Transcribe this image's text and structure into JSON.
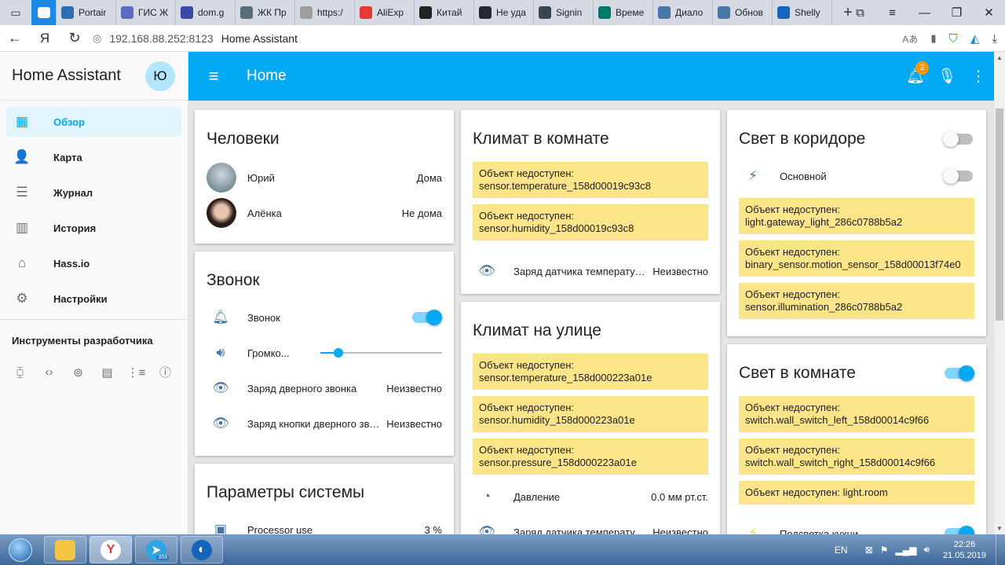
{
  "browser": {
    "tabs": [
      {
        "label": "Portair",
        "color": "#2c6fb5",
        "active": false
      },
      {
        "label": "ГИС Ж",
        "color": "#5c6bc0",
        "active": false
      },
      {
        "label": "dom.g",
        "color": "#3949ab",
        "active": false
      },
      {
        "label": "ЖК Пр",
        "color": "#546e7a",
        "active": false
      },
      {
        "label": "https:/",
        "color": "#9e9e9e",
        "active": false
      },
      {
        "label": "AliExp",
        "color": "#e53935",
        "active": false
      },
      {
        "label": "Китай",
        "color": "#212121",
        "active": false
      },
      {
        "label": "Не уда",
        "color": "#24292e",
        "active": false
      },
      {
        "label": "Signin",
        "color": "#37474f",
        "active": false
      },
      {
        "label": "Време",
        "color": "#00796b",
        "active": false
      },
      {
        "label": "Диало",
        "color": "#4a76a8",
        "active": false
      },
      {
        "label": "Обнов",
        "color": "#4a76a8",
        "active": false
      },
      {
        "label": "Shelly",
        "color": "#1565c0",
        "active": false
      }
    ],
    "address_host": "192.168.88.252:8123",
    "address_title": "Home Assistant"
  },
  "sidebar": {
    "title": "Home Assistant",
    "avatar_initial": "Ю",
    "items": [
      {
        "label": "Обзор",
        "icon": "grid-icon",
        "glyph": "▦",
        "active": true
      },
      {
        "label": "Карта",
        "icon": "account-box-icon",
        "glyph": "👤",
        "active": false
      },
      {
        "label": "Журнал",
        "icon": "list-icon",
        "glyph": "☰",
        "active": false
      },
      {
        "label": "История",
        "icon": "chart-bar-icon",
        "glyph": "▥",
        "active": false
      },
      {
        "label": "Hass.io",
        "icon": "home-assistant-icon",
        "glyph": "⌂",
        "active": false
      },
      {
        "label": "Настройки",
        "icon": "gear-icon",
        "glyph": "⚙",
        "active": false
      }
    ],
    "dev_tools_label": "Инструменты разработчика"
  },
  "toolbar": {
    "title": "Home",
    "notification_count": "2"
  },
  "cards": {
    "people": {
      "title": "Человеки",
      "rows": [
        {
          "name": "Юрий",
          "state": "Дома"
        },
        {
          "name": "Алёнка",
          "state": "Не дома"
        }
      ]
    },
    "doorbell": {
      "title": "Звонок",
      "rows": [
        {
          "name": "Звонок",
          "type": "toggle",
          "on": true
        },
        {
          "name": "Громко...",
          "type": "slider",
          "level": 0.15
        },
        {
          "name": "Заряд дверного звонка",
          "value": "Неизвестно"
        },
        {
          "name": "Заряд кнопки дверного звонка",
          "value": "Неизвестно"
        }
      ]
    },
    "system": {
      "title": "Параметры системы",
      "rows": [
        {
          "name": "Processor use",
          "value": "3 %"
        }
      ]
    },
    "climate_room": {
      "title": "Климат в комнате",
      "warnings": [
        {
          "label": "Объект недоступен:",
          "entity": "sensor.temperature_158d00019c93c8"
        },
        {
          "label": "Объект недоступен:",
          "entity": "sensor.humidity_158d00019c93c8"
        }
      ],
      "rows": [
        {
          "name": "Заряд датчика температуры",
          "value": "Неизвестно"
        }
      ]
    },
    "climate_outside": {
      "title": "Климат на улице",
      "warnings": [
        {
          "label": "Объект недоступен:",
          "entity": "sensor.temperature_158d000223a01e"
        },
        {
          "label": "Объект недоступен:",
          "entity": "sensor.humidity_158d000223a01e"
        },
        {
          "label": "Объект недоступен:",
          "entity": "sensor.pressure_158d000223a01e"
        }
      ],
      "rows": [
        {
          "name": "Давление",
          "value": "0.0 мм рт.ст."
        },
        {
          "name": "Заряд датчика температуры",
          "value": "Неизвестно"
        }
      ]
    },
    "light_corridor": {
      "title": "Свет в коридоре",
      "header_toggle_on": false,
      "rows": [
        {
          "name": "Основной",
          "on": false
        }
      ],
      "warnings": [
        {
          "label": "Объект недоступен:",
          "entity": "light.gateway_light_286c0788b5a2"
        },
        {
          "label": "Объект недоступен:",
          "entity": "binary_sensor.motion_sensor_158d00013f74e0"
        },
        {
          "label": "Объект недоступен:",
          "entity": "sensor.illumination_286c0788b5a2"
        }
      ]
    },
    "light_room": {
      "title": "Свет в комнате",
      "header_toggle_on": true,
      "warnings": [
        {
          "label": "Объект недоступен:",
          "entity": "switch.wall_switch_left_158d00014c9f66"
        },
        {
          "label": "Объект недоступен:",
          "entity": "switch.wall_switch_right_158d00014c9f66"
        },
        {
          "label": "Объект недоступен: light.room",
          "entity": ""
        }
      ],
      "rows": [
        {
          "name": "Подсветка кухни",
          "on": true
        }
      ]
    }
  },
  "taskbar": {
    "telegram_count": "359",
    "lang": "EN",
    "time": "22:26",
    "date": "21.05.2019"
  },
  "colors": {
    "primary": "#03a9f4",
    "state_icon": "#44739e",
    "warning_bg": "#fce588"
  }
}
